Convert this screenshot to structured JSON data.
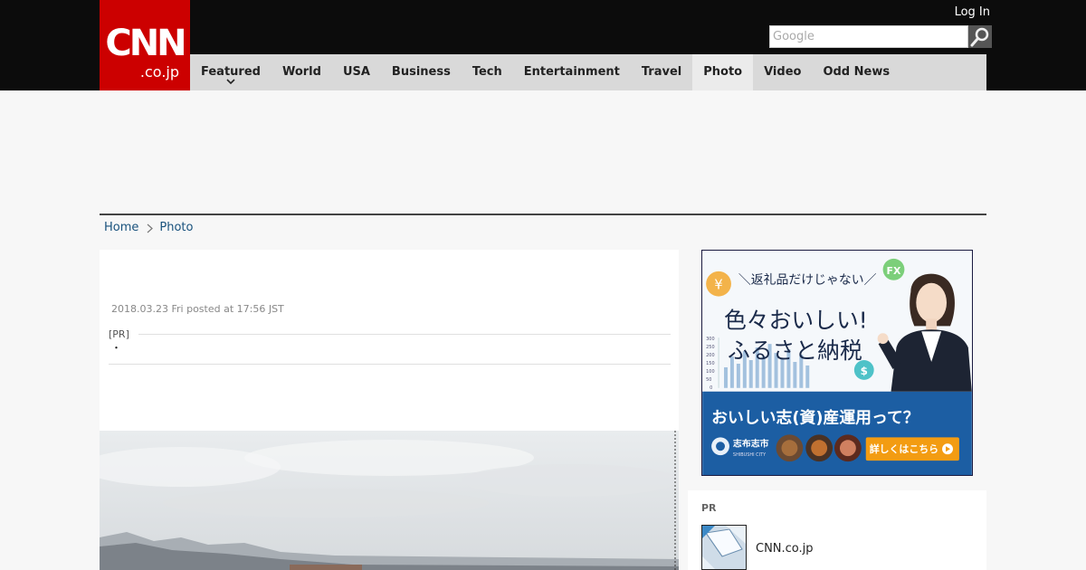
{
  "header": {
    "logo": {
      "main": "CNN",
      "sub": ".co.jp"
    },
    "login_label": "Log In",
    "search": {
      "placeholder": "Google"
    }
  },
  "nav": {
    "items": [
      {
        "label": "Featured"
      },
      {
        "label": "World"
      },
      {
        "label": "USA"
      },
      {
        "label": "Business"
      },
      {
        "label": "Tech"
      },
      {
        "label": "Entertainment"
      },
      {
        "label": "Travel"
      },
      {
        "label": "Photo"
      },
      {
        "label": "Video"
      },
      {
        "label": "Odd News"
      }
    ],
    "active": "Photo"
  },
  "breadcrumb": {
    "home": "Home",
    "current": "Photo"
  },
  "article": {
    "posted": "2018.03.23 Fri posted at 17:56 JST",
    "pr_label": "[PR]",
    "pr_text": "・"
  },
  "ad": {
    "top_line": "＼返礼品だけじゃない／",
    "headline_1": "色々おいしい!",
    "headline_2": "ふるさと納税",
    "bottom_headline": "おいしい志(資)産運用って？",
    "city_name": "志布志市",
    "city_roman": "SHIBUSHI CITY",
    "cta": "詳しくはこちら",
    "badge_fx": "FX",
    "badge_yen": "¥",
    "badge_dollar": "$",
    "chart_ticks": [
      "300",
      "250",
      "200",
      "150",
      "100",
      "50",
      "0"
    ]
  },
  "pr_box": {
    "title": "PR",
    "item_title": "CNN.co.jp"
  },
  "colors": {
    "brand_red": "#cc0000",
    "nav_bg": "#d9d9d9",
    "link": "#19527d"
  }
}
